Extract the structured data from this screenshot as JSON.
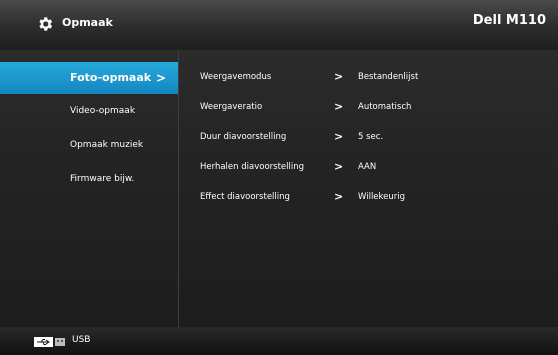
{
  "header": {
    "title": "Opmaak",
    "device": "Dell M110",
    "icon": "gear-icon"
  },
  "nav": {
    "items": [
      {
        "label": "Foto-opmaak",
        "active": true,
        "chevron": ">"
      },
      {
        "label": "Video-opmaak",
        "active": false
      },
      {
        "label": "Opmaak muziek",
        "active": false
      },
      {
        "label": "Firmware bijw.",
        "active": false
      }
    ]
  },
  "settings": {
    "rows": [
      {
        "label": "Weergavemodus",
        "arrow": ">",
        "value": "Bestandenlijst"
      },
      {
        "label": "Weergaveratio",
        "arrow": ">",
        "value": "Automatisch"
      },
      {
        "label": "Duur diavoorstelling",
        "arrow": ">",
        "value": "5 sec."
      },
      {
        "label": "Herhalen diavoorstelling",
        "arrow": ">",
        "value": "AAN"
      },
      {
        "label": "Effect diavoorstelling",
        "arrow": ">",
        "value": "Willekeurig"
      }
    ]
  },
  "footer": {
    "source_label": "USB",
    "icon": "usb-icon"
  },
  "colors": {
    "accent": "#1b97cf",
    "background": "#262626",
    "text": "#ffffff"
  }
}
